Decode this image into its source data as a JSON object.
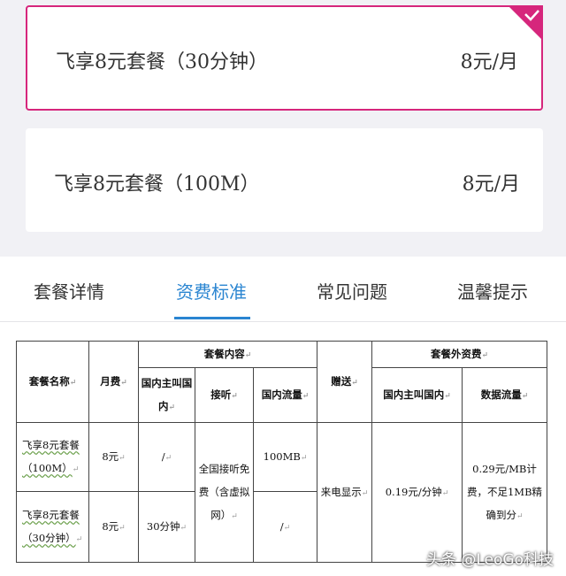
{
  "plans": [
    {
      "name": "飞享8元套餐（30分钟）",
      "price": "8元/月",
      "selected": true
    },
    {
      "name": "飞享8元套餐（100M）",
      "price": "8元/月",
      "selected": false
    }
  ],
  "tabs": [
    "套餐详情",
    "资费标准",
    "常见问题",
    "温馨提示"
  ],
  "active_tab": "资费标准",
  "table": {
    "headers": {
      "name": "套餐名称",
      "monthly_fee": "月费",
      "package_content": "套餐内容",
      "domestic_calls": "国内主叫国内",
      "answer": "接听",
      "domestic_data": "国内流量",
      "bonus": "赠送",
      "extra_fees": "套餐外资费",
      "extra_calls": "国内主叫国内",
      "data_traffic": "数据流量"
    },
    "rows": [
      {
        "name": "飞享8元套餐（100M）",
        "monthly_fee": "8元",
        "calls": "/",
        "answer": "全国接听免费（含虚拟网）",
        "data": "100MB"
      },
      {
        "name": "飞享8元套餐（30分钟）",
        "monthly_fee": "8元",
        "calls": "30分钟",
        "data": "/"
      }
    ],
    "bonus": "来电显示",
    "extra_call_rate": "0.19元/分钟",
    "extra_data_rate": "0.29元/MB计费，不足1MB精确到分"
  },
  "watermark": "头条 @LeoGo科技",
  "colors": {
    "accent": "#d6267c",
    "tab_active": "#2a85d1",
    "background": "#f1f1f5"
  }
}
